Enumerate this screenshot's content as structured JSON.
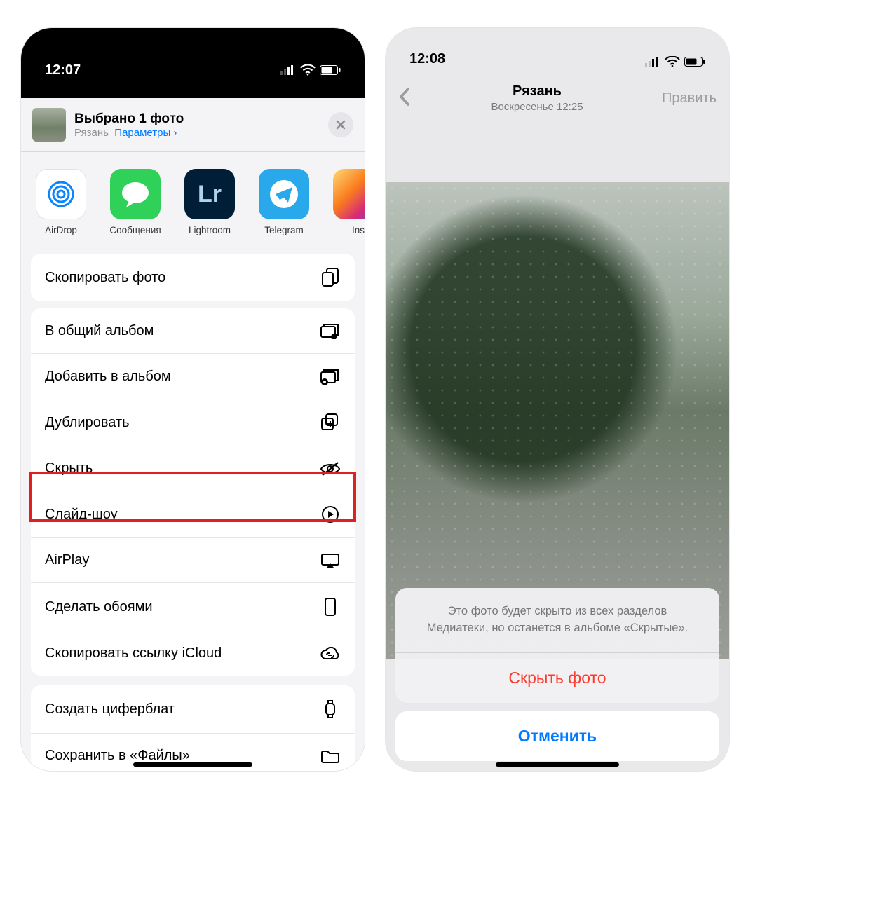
{
  "left": {
    "time": "12:07",
    "header_title": "Выбрано 1 фото",
    "location": "Рязань",
    "options_link": "Параметры",
    "apps": [
      {
        "name": "AirDrop"
      },
      {
        "name": "Сообщения"
      },
      {
        "name": "Lightroom"
      },
      {
        "name": "Telegram"
      },
      {
        "name": "Ins"
      }
    ],
    "actions_top": {
      "label": "Скопировать фото"
    },
    "actions_main": [
      {
        "label": "В общий альбом"
      },
      {
        "label": "Добавить в альбом"
      },
      {
        "label": "Дублировать"
      },
      {
        "label": "Скрыть"
      },
      {
        "label": "Слайд-шоу"
      },
      {
        "label": "AirPlay"
      },
      {
        "label": "Сделать обоями"
      },
      {
        "label": "Скопировать ссылку iCloud"
      }
    ],
    "actions_bottom": [
      {
        "label": "Создать циферблат"
      },
      {
        "label": "Сохранить в «Файлы»"
      }
    ]
  },
  "right": {
    "time": "12:08",
    "nav_title": "Рязань",
    "nav_sub": "Воскресенье 12:25",
    "nav_edit": "Править",
    "sheet_message": "Это фото будет скрыто из всех разделов Медиатеки, но останется в альбоме «Скрытые».",
    "sheet_destructive": "Скрыть фото",
    "sheet_cancel": "Отменить"
  }
}
